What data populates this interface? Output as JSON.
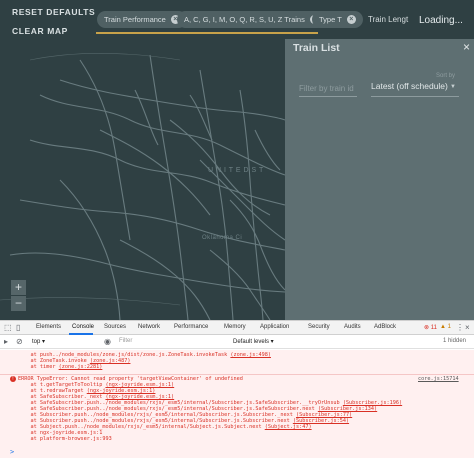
{
  "header": {
    "reset_label": "RESET DEFAULTS",
    "clear_label": "CLEAR MAP",
    "chips": [
      {
        "label": "Train Performance"
      },
      {
        "label": "A, C, G, I, M, O, Q, R, S, U, Z Trains"
      },
      {
        "label": "Type T"
      }
    ],
    "train_length_label": "Train Lengt",
    "loading_label": "Loading...",
    "accent_color": "#c8a24a"
  },
  "map": {
    "country_label": "U N I T E D   S T",
    "city_label": "Oklahoma Ci",
    "zoom_in": "+",
    "zoom_out": "−"
  },
  "panel": {
    "title": "Train List",
    "close_icon": "×",
    "search_placeholder": "Filter by train id",
    "sort_label": "Sort by",
    "sort_value": "Latest (off schedule)",
    "sort_caret": "▼"
  },
  "devtools": {
    "tabs": [
      "Elements",
      "Console",
      "Sources",
      "Network",
      "Performance",
      "Memory",
      "Application",
      "Security",
      "Audits",
      "AdBlock"
    ],
    "active_tab": "Console",
    "context": "top",
    "filter_placeholder": "Filter",
    "levels": "Default levels ▾",
    "error_count": "11",
    "warn_count": "1",
    "hidden": "1 hidden",
    "lines": [
      {
        "text": "    at push../node_modules/zone.js/dist/zone.js.ZoneTask.invokeTask ",
        "src": "(zone.js:498)"
      },
      {
        "text": "    at ZoneTask.invoke ",
        "src": "(zone.js:487)"
      },
      {
        "text": "    at timer ",
        "src": "(zone.js:2281)"
      },
      {
        "text": "ERROR TypeError: Cannot read property 'targetViewContainer' of undefined",
        "src": "core.js:15714",
        "is_error": true
      },
      {
        "text": "    at t.getTargetToTooltip ",
        "src": "(ngx-joyride.esm.js:1)"
      },
      {
        "text": "    at t.redrawTarget ",
        "src": "(ngx-joyride.esm.js:1)"
      },
      {
        "text": "    at SafeSubscriber._next ",
        "src": "(ngx-joyride.esm.js:1)"
      },
      {
        "text": "    at SafeSubscriber.push../node_modules/rxjs/_esm5/internal/Subscriber.js.SafeSubscriber.__tryOrUnsub ",
        "src": "(Subscriber.js:196)"
      },
      {
        "text": "    at SafeSubscriber.push../node_modules/rxjs/_esm5/internal/Subscriber.js.SafeSubscriber.next ",
        "src": "(Subscriber.js:134)"
      },
      {
        "text": "    at Subscriber.push../node_modules/rxjs/_esm5/internal/Subscriber.js.Subscriber._next ",
        "src": "(Subscriber.js:77)"
      },
      {
        "text": "    at Subscriber.push../node_modules/rxjs/_esm5/internal/Subscriber.js.Subscriber.next ",
        "src": "(Subscriber.js:54)"
      },
      {
        "text": "    at Subject.push../node_modules/rxjs/_esm5/internal/Subject.js.Subject.next ",
        "src": "(Subject.js:47)"
      },
      {
        "text": "    at ngx-joyride.esm.js:1",
        "src": ""
      },
      {
        "text": "    at platform-browser.js:993",
        "src": ""
      }
    ],
    "prompt": ">"
  }
}
